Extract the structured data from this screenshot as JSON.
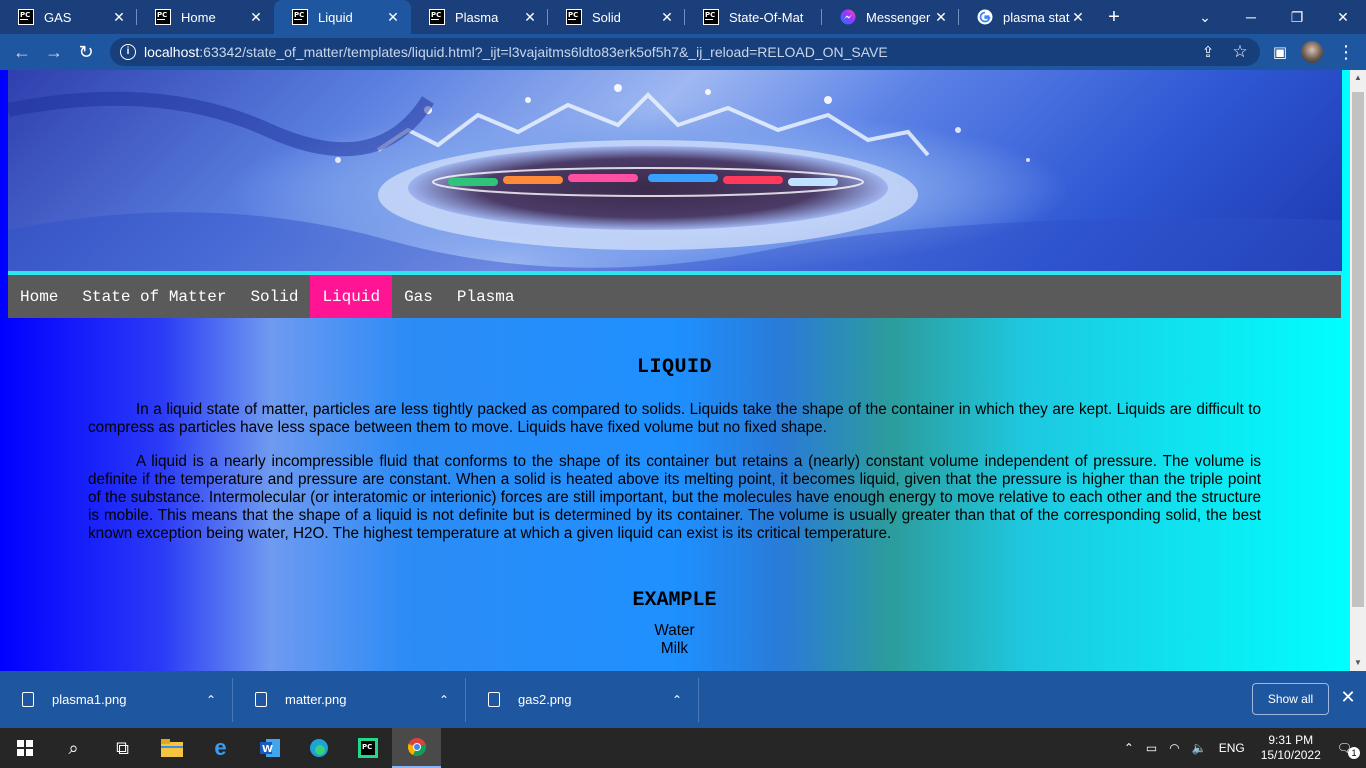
{
  "browser": {
    "tabs": [
      {
        "title": "GAS",
        "icon": "pycharm-icon",
        "active": false
      },
      {
        "title": "Home",
        "icon": "pycharm-icon",
        "active": false
      },
      {
        "title": "Liquid",
        "icon": "pycharm-icon",
        "active": true
      },
      {
        "title": "Plasma",
        "icon": "pycharm-icon",
        "active": false
      },
      {
        "title": "Solid",
        "icon": "pycharm-icon",
        "active": false
      },
      {
        "title": "State-Of-Mat",
        "icon": "pycharm-icon",
        "active": false
      },
      {
        "title": "Messenger",
        "icon": "messenger-icon",
        "active": false
      },
      {
        "title": "plasma state",
        "icon": "google-icon",
        "active": false
      }
    ],
    "url_host": "localhost",
    "url_rest": ":63342/state_of_matter/templates/liquid.html?_ijt=l3vajaitms6ldto83erk5of5h7&_ij_reload=RELOAD_ON_SAVE"
  },
  "page": {
    "nav": [
      "Home",
      "State of Matter",
      "Solid",
      "Liquid",
      "Gas",
      "Plasma"
    ],
    "active_nav": "Liquid",
    "heading": "LIQUID",
    "paragraphs": [
      "In a liquid state of matter, particles are less tightly packed as compared to solids. Liquids take the shape of the container in which they are kept. Liquids are difficult to compress as particles have less space between them to move. Liquids have fixed volume but no fixed shape.",
      "A liquid is a nearly incompressible fluid that conforms to the shape of its container but retains a (nearly) constant volume independent of pressure. The volume is definite if the temperature and pressure are constant. When a solid is heated above its melting point, it becomes liquid, given that the pressure is higher than the triple point of the substance. Intermolecular (or interatomic or interionic) forces are still important, but the molecules have enough energy to move relative to each other and the structure is mobile. This means that the shape of a liquid is not definite but is determined by its container. The volume is usually greater than that of the corresponding solid, the best known exception being water, H2O. The highest temperature at which a given liquid can exist is its critical temperature."
    ],
    "example_heading": "EXAMPLE",
    "examples": [
      "Water",
      "Milk"
    ]
  },
  "downloads": {
    "items": [
      "plasma1.png",
      "matter.png",
      "gas2.png"
    ],
    "show_all": "Show all"
  },
  "taskbar": {
    "lang": "ENG",
    "time": "9:31 PM",
    "date": "15/10/2022",
    "notification_count": "1"
  },
  "colors": {
    "tab_strip": "#1a3f7a",
    "toolbar": "#1e56a0",
    "nav_bg": "#5a5a5a",
    "nav_active": "#ff1493"
  }
}
